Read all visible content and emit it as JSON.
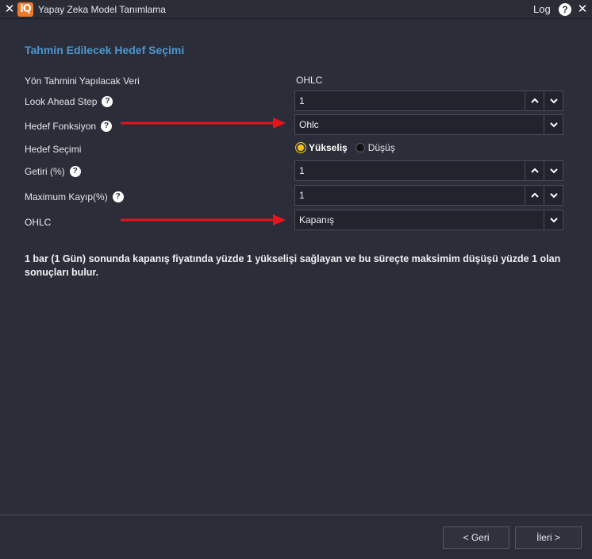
{
  "window": {
    "title": "Yapay Zeka Model Tanımlama",
    "logo_text": "iQ",
    "log_label": "Log",
    "help_symbol": "?",
    "close_symbol": "✕"
  },
  "section_title": "Tahmin Edilecek Hedef Seçimi",
  "rows": {
    "yon": {
      "label": "Yön Tahmini Yapılacak Veri",
      "value": "OHLC"
    },
    "look_ahead": {
      "label": "Look Ahead Step",
      "value": "1"
    },
    "hedef_fonksiyon": {
      "label": "Hedef Fonksiyon",
      "value": "Ohlc"
    },
    "hedef_secimi": {
      "label": "Hedef Seçimi",
      "option_selected": "Yükseliş",
      "option_other": "Düşüş"
    },
    "getiri": {
      "label": "Getiri (%)",
      "value": "1"
    },
    "max_kayip": {
      "label": "Maximum Kayıp(%)",
      "value": "1"
    },
    "ohlc": {
      "label": "OHLC",
      "value": "Kapanış"
    }
  },
  "description": "1 bar (1 Gün) sonunda kapanış fiyatında yüzde 1 yükselişi sağlayan ve bu süreçte maksimim düşüşü yüzde 1 olan sonuçları bulur.",
  "footer": {
    "back_label": "< Geri",
    "next_label": "İleri >"
  },
  "colors": {
    "background": "#2b2d38",
    "accent_title": "#4e97cf",
    "logo": "#f0782a",
    "radio_selected": "#f3c316",
    "annotation_arrow": "#e8141b"
  },
  "icons": {
    "spin_up": "chevron-up-icon",
    "spin_down": "chevron-down-icon",
    "dropdown": "chevron-down-icon",
    "help": "question-circle-icon"
  }
}
